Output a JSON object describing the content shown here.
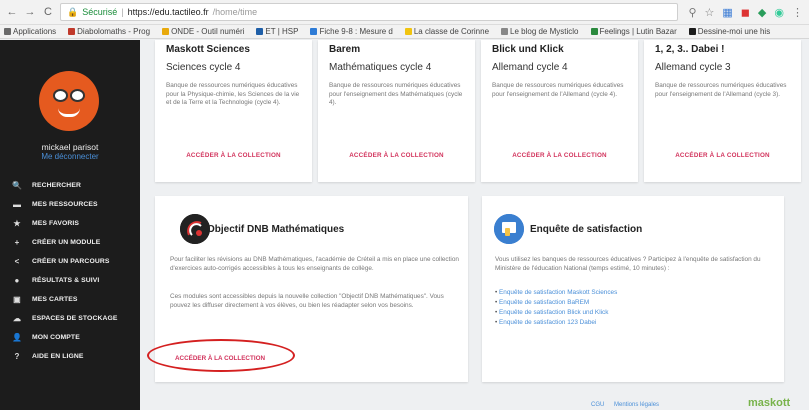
{
  "browser": {
    "secure_label": "Sécurisé",
    "url_host": "https://edu.tactileo.fr",
    "url_path": "/home/time"
  },
  "bookmarks": [
    {
      "label": "Applications",
      "color": "#6a6a6a"
    },
    {
      "label": "Diabolomaths - Prog",
      "color": "#c0392b"
    },
    {
      "label": "ONDE - Outil numéri",
      "color": "#e8a90c"
    },
    {
      "label": "ET | HSP",
      "color": "#1f5fa8"
    },
    {
      "label": "Fiche 9-8 : Mesure d",
      "color": "#2e7bd6"
    },
    {
      "label": "La classe de Corinne",
      "color": "#f1c40f"
    },
    {
      "label": "Le blog de Mysticlo",
      "color": "#888888"
    },
    {
      "label": "Feelings | Lutin Bazar",
      "color": "#2b8a3e"
    },
    {
      "label": "Dessine-moi une his",
      "color": "#1b1b1b"
    }
  ],
  "user": {
    "name": "mickael parisot",
    "logout": "Me déconnecter"
  },
  "menu": [
    {
      "icon": "🔍",
      "label": "RECHERCHER"
    },
    {
      "icon": "▬",
      "label": "MES RESSOURCES"
    },
    {
      "icon": "★",
      "label": "MES FAVORIS"
    },
    {
      "icon": "+",
      "label": "CRÉER UN MODULE"
    },
    {
      "icon": "<",
      "label": "CRÉER UN PARCOURS"
    },
    {
      "icon": "●",
      "label": "RÉSULTATS & SUIVI"
    },
    {
      "icon": "▣",
      "label": "MES CARTES"
    },
    {
      "icon": "☁",
      "label": "ESPACES DE STOCKAGE"
    },
    {
      "icon": "👤",
      "label": "MON COMPTE"
    },
    {
      "icon": "?",
      "label": "AIDE EN LIGNE"
    }
  ],
  "collections": [
    {
      "title": "Maskott Sciences",
      "subtitle": "Sciences cycle 4",
      "description": "Banque de ressources numériques éducatives pour la Physique-chimie, les Sciences de la vie et de la Terre et la Technologie (cycle 4).",
      "link": "ACCÉDER À LA COLLECTION"
    },
    {
      "title": "Barem",
      "subtitle": "Mathématiques cycle 4",
      "description": "Banque de ressources numériques éducatives pour l'enseignement des Mathématiques (cycle 4).",
      "link": "ACCÉDER À LA COLLECTION"
    },
    {
      "title": "Blick und Klick",
      "subtitle": "Allemand cycle 4",
      "description": "Banque de ressources numériques éducatives pour l'enseignement de l'Allemand (cycle 4).",
      "link": "ACCÉDER À LA COLLECTION"
    },
    {
      "title": "1, 2, 3.. Dabei !",
      "subtitle": "Allemand cycle 3",
      "description": "Banque de ressources numériques éducatives pour l'enseignement de l'Allemand (cycle 3).",
      "link": "ACCÉDER À LA COLLECTION"
    }
  ],
  "dnb": {
    "title": "Objectif DNB Mathématiques",
    "para1": "Pour faciliter les révisions au DNB Mathématiques, l'académie de Créteil a mis en place une collection d'exercices auto-corrigés accessibles à tous les enseignants de collège.",
    "para2": "Ces modules sont accessibles depuis la nouvelle collection \"Objectif DNB Mathématiques\". Vous pouvez les diffuser directement à vos élèves, ou bien les réadapter selon vos besoins.",
    "link": "ACCÉDER À LA COLLECTION"
  },
  "survey": {
    "title": "Enquête de satisfaction",
    "intro": "Vous utilisez les banques de ressources éducatives ? Participez à l'enquête de satisfaction du Ministère de l'éducation National (temps estimé, 10 minutes) :",
    "links": [
      "Enquête de satisfaction Maskott Sciences",
      "Enquête de satisfaction BaREM",
      "Enquête de satisfaction Blick und Klick",
      "Enquête de satisfaction 123 Dabei"
    ]
  },
  "footer": {
    "link1": "CGU",
    "link2": "Mentions légales",
    "brand": "maskott"
  },
  "colors": {
    "accent": "#d2335c",
    "sidebar": "#1c1c1c",
    "link": "#4a8fd8",
    "avatar": "#e55a1f",
    "annotation": "#d42020"
  }
}
